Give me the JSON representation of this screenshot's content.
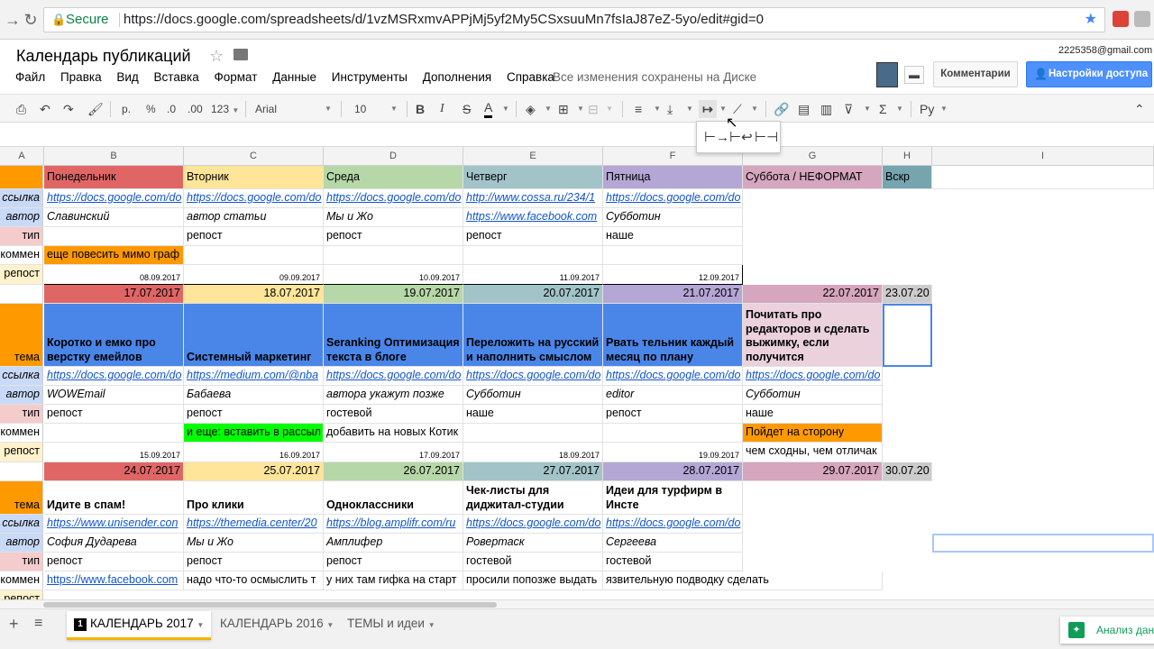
{
  "browser": {
    "secure_label": "Secure",
    "url": "https://docs.google.com/spreadsheets/d/1vzMSRxmvAPPjMj5yf2My5CSxsuuMn7fsIaJ87eZ-5yo/edit#gid=0"
  },
  "doc": {
    "title": "Календарь публикаций",
    "menu": [
      "Файл",
      "Правка",
      "Вид",
      "Вставка",
      "Формат",
      "Данные",
      "Инструменты",
      "Дополнения",
      "Справка"
    ],
    "saved_status": "Все изменения сохранены на Диске",
    "account_email": "2225358@gmail.com",
    "comments_label": "Комментарии",
    "share_label": "Настройки доступа"
  },
  "toolbar": {
    "currency": "р.",
    "percent": "%",
    "decimal_less": ".0",
    "decimal_more": ".00",
    "format_more": "123",
    "font": "Arial",
    "font_size": "10",
    "bold": "B",
    "italic": "I",
    "strike": "S",
    "text_color": "A",
    "sum": "Σ",
    "input_tools": "Ру"
  },
  "columns": [
    "A",
    "B",
    "C",
    "D",
    "E",
    "F",
    "G",
    "H",
    "I"
  ],
  "days": [
    "Понедельник",
    "Вторник",
    "Среда",
    "Четверг",
    "Пятница",
    "Суббота / НЕФОРМАТ",
    "Вскр"
  ],
  "row_labels": {
    "link": "ссылка",
    "author": "автор",
    "type": "тип",
    "comment": "коммен",
    "repost": "репост",
    "topic": "тема"
  },
  "block1": {
    "links": [
      "https://docs.google.com/do",
      "https://docs.google.com/do",
      "https://docs.google.com/do",
      "http://www.cossa.ru/234/1",
      "https://docs.google.com/do"
    ],
    "authors": [
      "Славинский",
      "автор статьи",
      "Мы и Жо",
      "https://www.facebook.com",
      "Субботин"
    ],
    "types": [
      "",
      "репост",
      "репост",
      "репост",
      "наше"
    ],
    "comment_b": "еще повесить мимо граф",
    "dates": [
      "08.09.2017",
      "09.09.2017",
      "10.09.2017",
      "11.09.2017",
      "12.09.2017"
    ]
  },
  "week2": {
    "dates": [
      "17.07.2017",
      "18.07.2017",
      "19.07.2017",
      "20.07.2017",
      "21.07.2017",
      "22.07.2017",
      "23.07.20"
    ],
    "topics": [
      "Коротко и емко про верстку емейлов",
      "Системный маркетинг",
      "Seranking Оптимизация текста в блоге",
      "Переложить на русский и наполнить смыслом",
      "Рвать тельник каждый месяц по плану",
      "Почитать про редакторов и сделать выжимку, если получится"
    ],
    "links": [
      "https://docs.google.com/do",
      "https://medium.com/@nba",
      "https://docs.google.com/do",
      "https://docs.google.com/do",
      "https://docs.google.com/do",
      "https://docs.google.com/do"
    ],
    "authors": [
      "WOWEmail",
      "Бабаева",
      "авторa укажут позже",
      "Субботин",
      "editor",
      "Субботин"
    ],
    "types": [
      "репост",
      "репост",
      "гостевой",
      "наше",
      "репост",
      "наше"
    ],
    "comments": [
      "",
      "и еще: вставить в рассыл",
      "добавить на новых Котик",
      "",
      "",
      "Пойдет на сторону"
    ],
    "repost_dates": [
      "15.09.2017",
      "16.09.2017",
      "17.09.2017",
      "18.09.2017",
      "19.09.2017"
    ],
    "repost_g": "чем сходны, чем отличак"
  },
  "week3": {
    "dates": [
      "24.07.2017",
      "25.07.2017",
      "26.07.2017",
      "27.07.2017",
      "28.07.2017",
      "29.07.2017",
      "30.07.20"
    ],
    "topics": [
      "Идите в спам!",
      "Про клики",
      "Одноклассники",
      "Чек-листы для диджитал-студии",
      "Идеи для турфирм в Инсте"
    ],
    "links": [
      "https://www.unisender.con",
      "https://themedia.center/20",
      "https://blog.amplifr.com/ru",
      "https://docs.google.com/do",
      "https://docs.google.com/do"
    ],
    "authors": [
      "София Дударева",
      "Мы и Жо",
      "Амплифер",
      "Ровертаск",
      "Сергеева"
    ],
    "types": [
      "репост",
      "репост",
      "репост",
      "гостевой",
      "гостевой"
    ],
    "comments": [
      "https://www.facebook.com",
      "надо что-то осмыслить т",
      "у них там гифка на старт",
      "просили попозже выдать",
      "язвительную подводку сделать"
    ]
  },
  "sheets": {
    "active_number": "1",
    "tabs": [
      "КАЛЕНДАРЬ 2017",
      "КАЛЕНДАРЬ 2016",
      "ТЕМЫ и идеи"
    ]
  },
  "explore_label": "Анализ дан",
  "colors": {
    "monday": "#e06666",
    "tuesday": "#ffe599",
    "wednesday": "#b6d7a8",
    "thursday": "#a2c4c9",
    "friday": "#b4a7d6",
    "saturday": "#d5a6bd",
    "sunday": "#76a5af",
    "topic_blue": "#4a86e8",
    "orange": "#ff9900",
    "green": "#00ff00",
    "label_link": "#c9daf8",
    "label_author": "#c9daf8",
    "label_type": "#f4cccc",
    "label_repost": "#fff2cc"
  }
}
